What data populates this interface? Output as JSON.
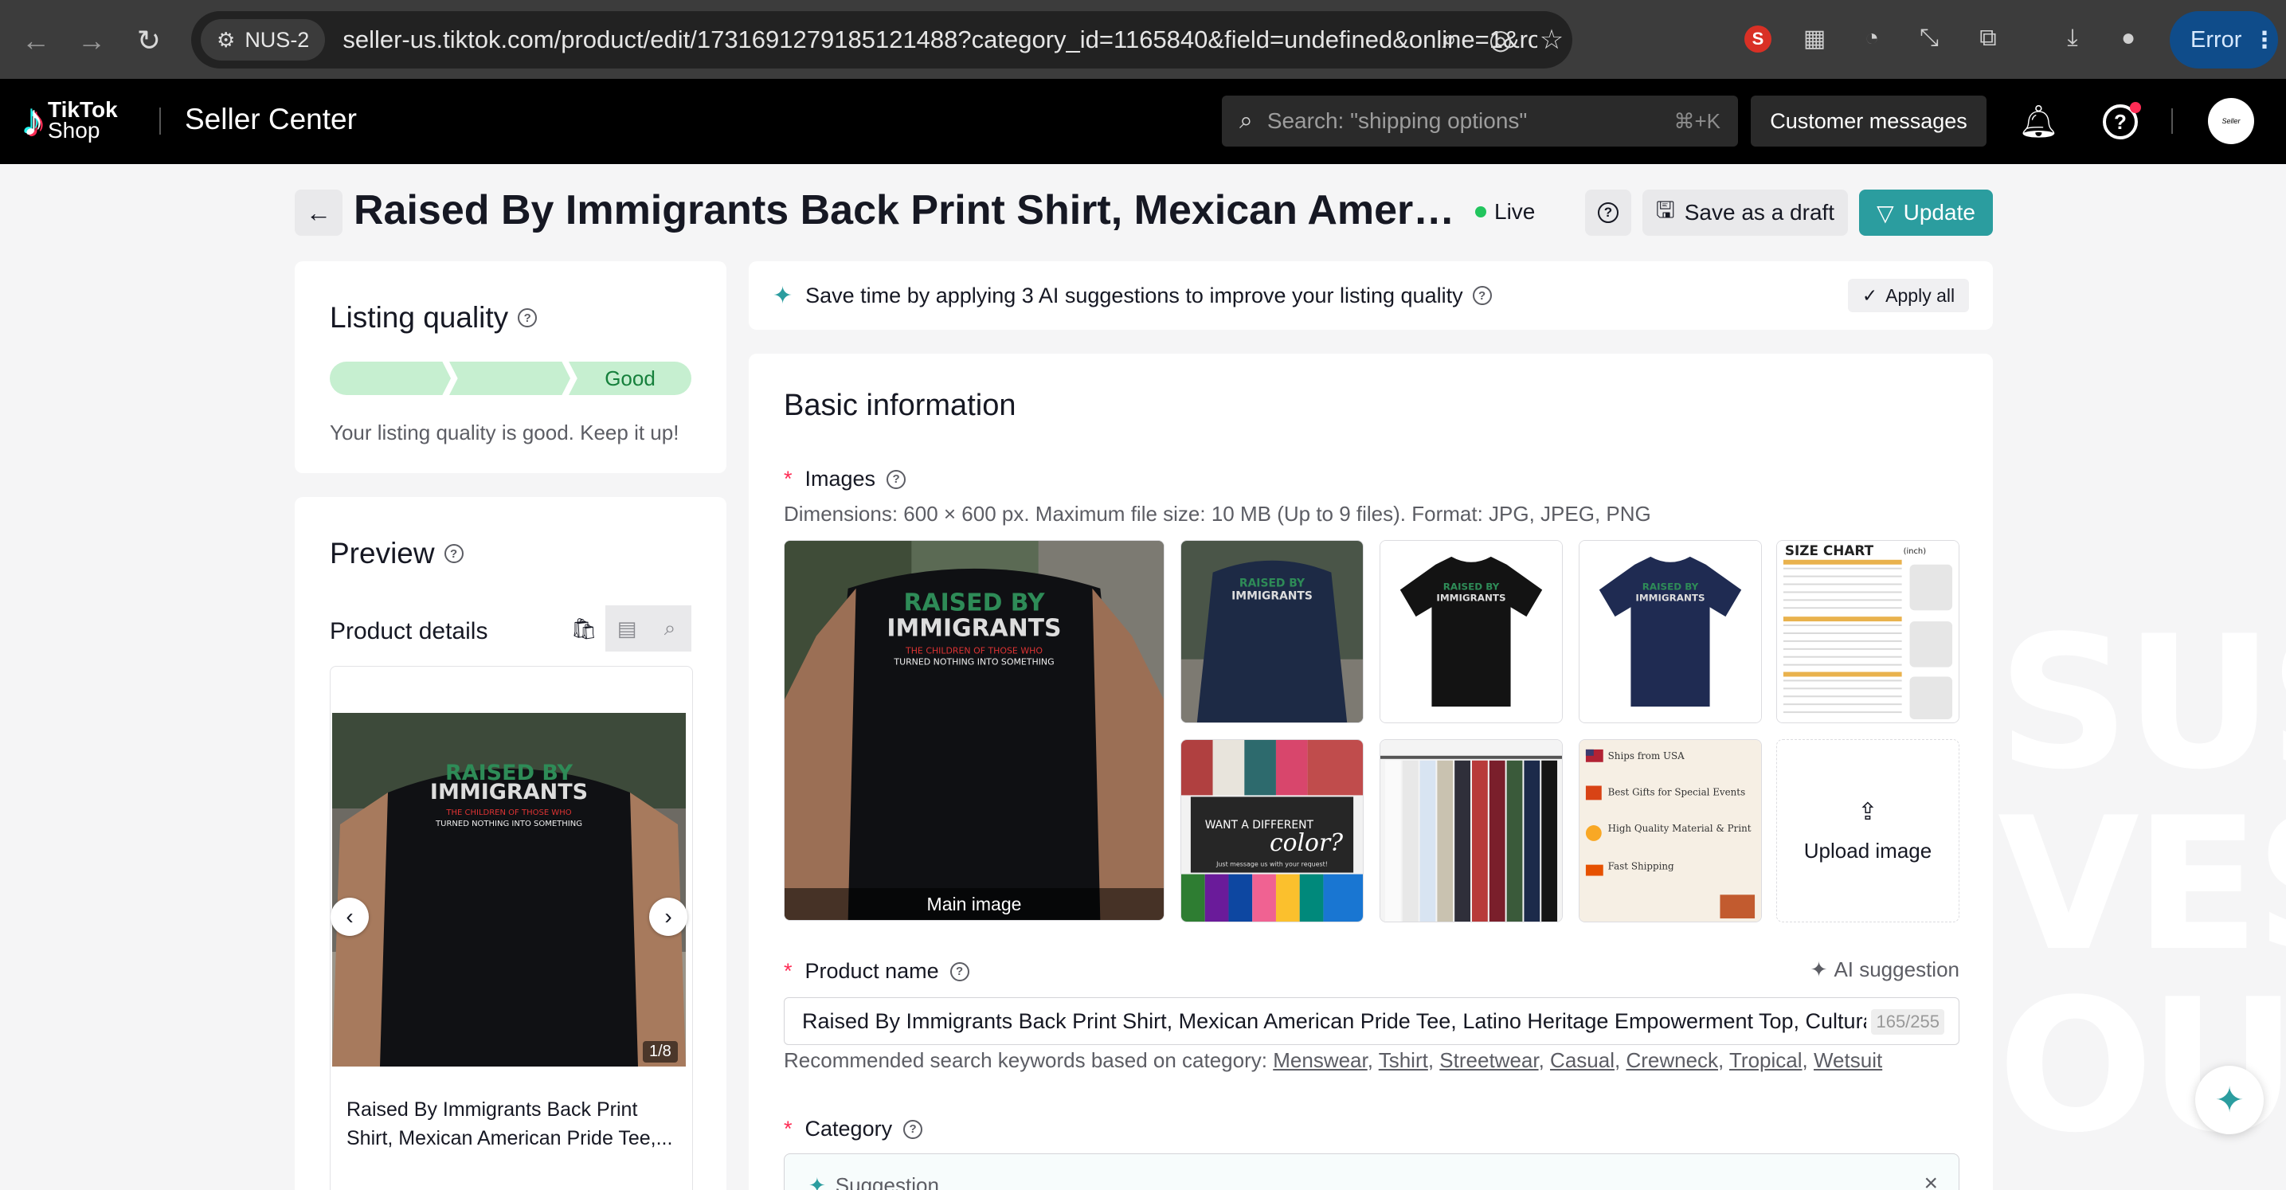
{
  "browser": {
    "site_chip": "NUS-2",
    "url": "seller-us.tiktok.com/product/edit/1731691279185121488?category_id=1165840&field=undefined&online=1&root_...",
    "error_label": "Error",
    "extension_badge": "S"
  },
  "header": {
    "logo_word1": "TikTok",
    "logo_word2": "Shop",
    "app_name": "Seller Center",
    "search_placeholder": "Search: \"shipping options\"",
    "search_shortcut": "⌘+K",
    "customer_messages": "Customer messages",
    "avatar_text": "Seller"
  },
  "page": {
    "title": "Raised By Immigrants Back Print Shirt, Mexican Americ...",
    "status": "Live",
    "save_draft": "Save as a draft",
    "update": "Update"
  },
  "listing_quality": {
    "title": "Listing quality",
    "level": "Good",
    "message": "Your listing quality is good. Keep it up!"
  },
  "preview": {
    "title": "Preview",
    "tab_label": "Product details",
    "counter": "1/8",
    "product_name": "Raised By Immigrants Back Print Shirt, Mexican American Pride Tee,..."
  },
  "ai_banner": {
    "text": "Save time by applying 3 AI suggestions to improve your listing quality",
    "apply_all": "Apply all"
  },
  "basic_info": {
    "title": "Basic information",
    "images_label": "Images",
    "images_hint": "Dimensions: 600 × 600 px. Maximum file size: 10 MB (Up to 9 files). Format: JPG, JPEG, PNG",
    "main_image_caption": "Main image",
    "upload_label": "Upload image",
    "image_texts": {
      "shirt_line1": "RAISED BY",
      "shirt_line2": "IMMIGRANTS",
      "shirt_line3": "THE CHILDREN OF THOSE WHO",
      "shirt_line4": "TURNED NOTHING INTO SOMETHING",
      "size_chart": "SIZE CHART",
      "size_chart_unit": "(inch)",
      "color_line1": "WANT A DIFFERENT",
      "color_line2": "color?",
      "color_line3": "Just message us with your request!",
      "feature1": "Ships from USA",
      "feature2": "Best Gifts for Special Events",
      "feature3": "High Quality Material & Print",
      "feature4": "Fast Shipping"
    },
    "product_name_label": "Product name",
    "ai_suggestion": "AI suggestion",
    "product_name_value": "Raised By Immigrants Back Print Shirt, Mexican American Pride Tee, Latino Heritage Empowerment Top, Cultural Identity Shirt",
    "char_count": "165/255",
    "keywords_label": "Recommended search keywords based on category:",
    "keywords": [
      "Menswear",
      "Tshirt",
      "Streetwear",
      "Casual",
      "Crewneck",
      "Tropical",
      "Wetsuit"
    ],
    "category_label": "Category",
    "suggestion_label": "Suggestion"
  },
  "background_text": "SUS\nVES\nOU",
  "colors": {
    "accent": "#2b9d9f",
    "live": "#22c55e",
    "required": "#fe2c55",
    "quality_good_bg": "#c6efd0"
  }
}
